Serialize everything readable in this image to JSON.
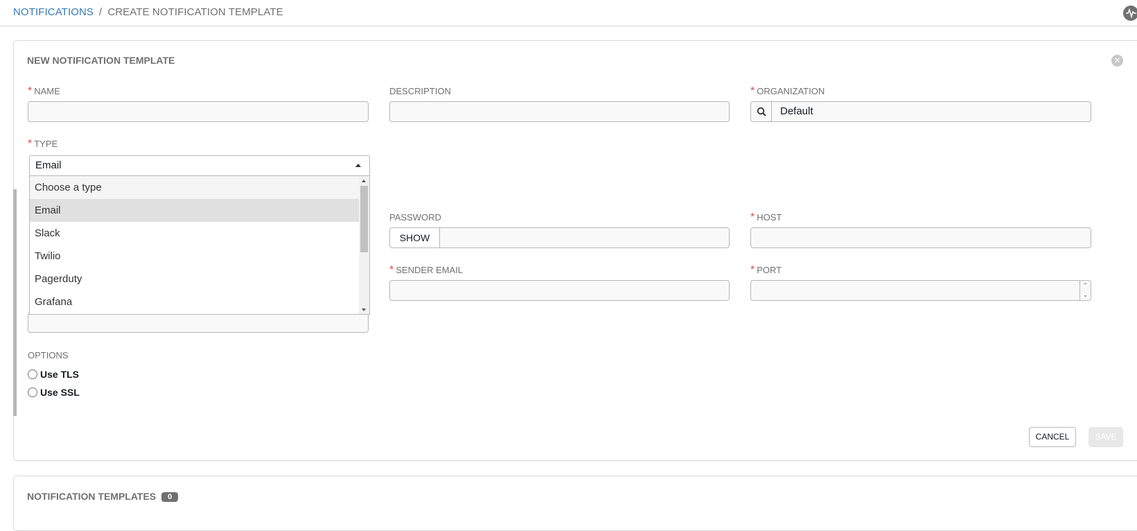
{
  "breadcrumb": {
    "parent": "NOTIFICATIONS",
    "separator": "/",
    "current": "CREATE NOTIFICATION TEMPLATE"
  },
  "form": {
    "title": "NEW NOTIFICATION TEMPLATE",
    "name_label": "NAME",
    "name_value": "",
    "description_label": "DESCRIPTION",
    "description_value": "",
    "organization_label": "ORGANIZATION",
    "organization_value": "Default",
    "type_label": "TYPE",
    "type_selected": "Email",
    "type_options": [
      "Choose a type",
      "Email",
      "Slack",
      "Twilio",
      "Pagerduty",
      "Grafana"
    ],
    "password_label": "PASSWORD",
    "password_show": "SHOW",
    "host_label": "HOST",
    "sender_email_label": "SENDER EMAIL",
    "port_label": "PORT",
    "options_label": "OPTIONS",
    "use_tls_label": "Use TLS",
    "use_ssl_label": "Use SSL",
    "cancel_label": "CANCEL",
    "save_label": "SAVE"
  },
  "list": {
    "title": "NOTIFICATION TEMPLATES",
    "count": "0"
  },
  "colors": {
    "link": "#337ab7",
    "required": "#d9534f",
    "muted": "#707070"
  },
  "icons": {
    "close": "close-icon",
    "search": "search-icon",
    "activity": "activity-stream-icon"
  }
}
